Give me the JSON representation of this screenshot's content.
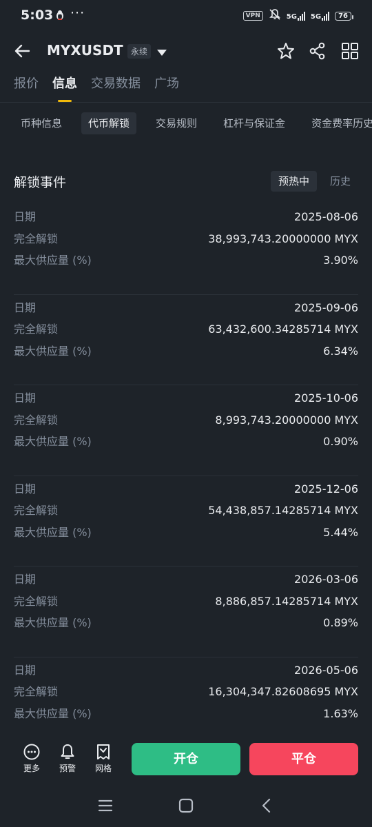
{
  "status_bar": {
    "time": "5:03",
    "dots": "···",
    "vpn": "VPN",
    "net1": "5G",
    "net2": "5G",
    "battery": "76"
  },
  "header": {
    "pair": "MYXUSDT",
    "badge": "永续"
  },
  "main_tabs": [
    {
      "label": "报价",
      "active": false
    },
    {
      "label": "信息",
      "active": true
    },
    {
      "label": "交易数据",
      "active": false
    },
    {
      "label": "广场",
      "active": false
    }
  ],
  "sub_tabs": [
    {
      "label": "币种信息",
      "active": false
    },
    {
      "label": "代币解锁",
      "active": true
    },
    {
      "label": "交易规则",
      "active": false
    },
    {
      "label": "杠杆与保证金",
      "active": false
    },
    {
      "label": "资金费率历史",
      "active": false
    }
  ],
  "section": {
    "title": "解锁事件",
    "toggle_active": "预热中",
    "toggle_other": "历史"
  },
  "event_labels": {
    "date": "日期",
    "unlock": "完全解锁",
    "supply": "最大供应量 (%)"
  },
  "events": [
    {
      "date": "2025-08-06",
      "unlock": "38,993,743.20000000 MYX",
      "supply": "3.90%"
    },
    {
      "date": "2025-09-06",
      "unlock": "63,432,600.34285714 MYX",
      "supply": "6.34%"
    },
    {
      "date": "2025-10-06",
      "unlock": "8,993,743.20000000 MYX",
      "supply": "0.90%"
    },
    {
      "date": "2025-12-06",
      "unlock": "54,438,857.14285714 MYX",
      "supply": "5.44%"
    },
    {
      "date": "2026-03-06",
      "unlock": "8,886,857.14285714 MYX",
      "supply": "0.89%"
    },
    {
      "date": "2026-05-06",
      "unlock": "16,304,347.82608695 MYX",
      "supply": "1.63%"
    }
  ],
  "actions": {
    "more": "更多",
    "alert": "预警",
    "grid": "网格",
    "open": "开仓",
    "close": "平仓"
  },
  "colors": {
    "background": "#1e2329",
    "accent": "#f0b90b",
    "buy": "#2ebd85",
    "sell": "#f6465d"
  }
}
